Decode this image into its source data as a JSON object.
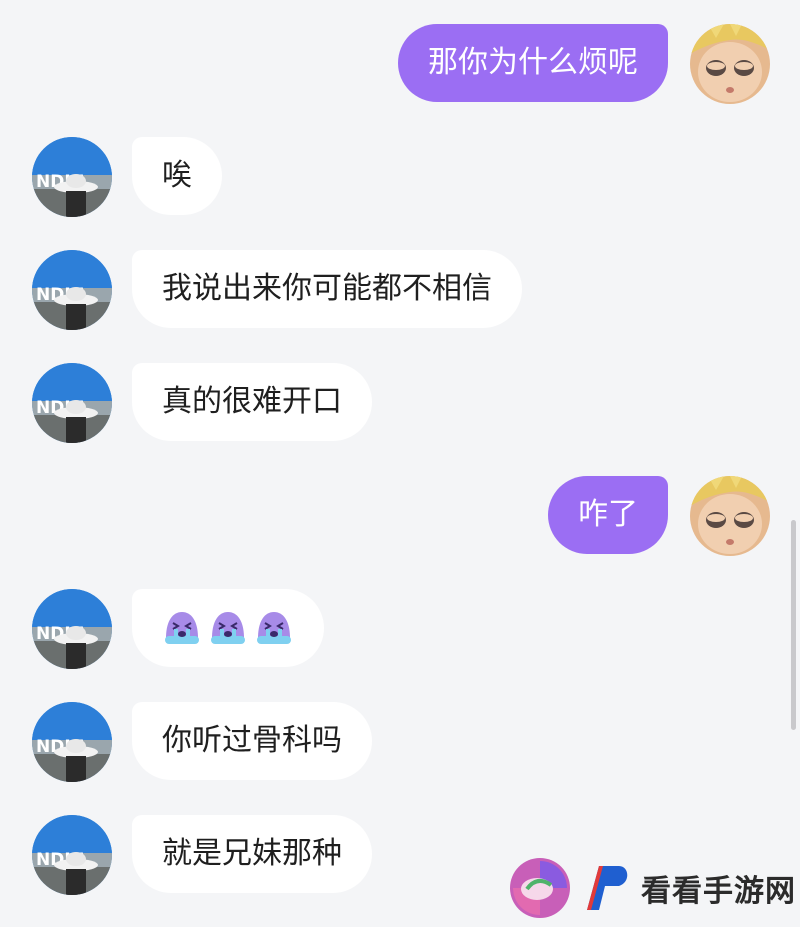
{
  "conversation": {
    "messages": [
      {
        "sender": "me",
        "text": "那你为什么烦呢"
      },
      {
        "sender": "friend",
        "text": "唉"
      },
      {
        "sender": "friend",
        "text": "我说出来你可能都不相信"
      },
      {
        "sender": "friend",
        "text": "真的很难开口"
      },
      {
        "sender": "me",
        "text": "咋了"
      },
      {
        "sender": "friend",
        "emoji": "crying-face-icon",
        "count": 3
      },
      {
        "sender": "friend",
        "text": "你听过骨科吗"
      },
      {
        "sender": "friend",
        "text": "就是兄妹那种"
      }
    ]
  },
  "watermark": {
    "text": "看看手游网"
  },
  "colors": {
    "background": "#f4f5f7",
    "outgoing_bubble": "#9b6ef3",
    "incoming_bubble": "#ffffff",
    "emoji_purple": "#a78be8",
    "emoji_tears": "#7fd0f0"
  }
}
